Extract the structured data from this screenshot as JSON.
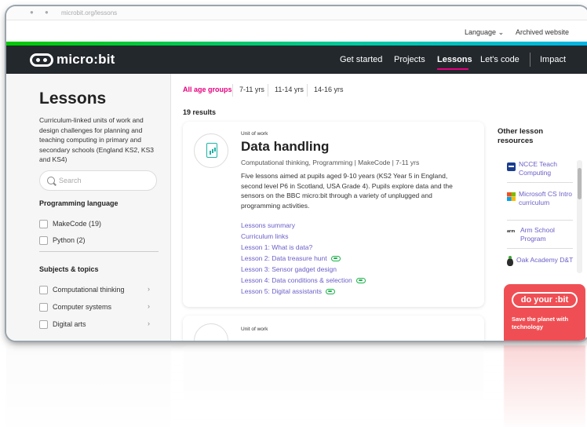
{
  "browser": {
    "url": "microbit.org/lessons"
  },
  "utility_nav": {
    "language": "Language",
    "archived": "Archived website"
  },
  "navbar": {
    "logo_text": "micro:bit",
    "items": [
      {
        "label": "Get started"
      },
      {
        "label": "Projects"
      },
      {
        "label": "Lessons"
      },
      {
        "label": "Let's code"
      },
      {
        "label": "Impact"
      }
    ],
    "active_item": "Lessons"
  },
  "sidebar": {
    "title": "Lessons",
    "description": "Curriculum-linked units of work and design challenges for planning and teaching computing in primary and secondary schools (England KS2, KS3 and KS4)",
    "search_placeholder": "Search",
    "programming_heading": "Programming language",
    "languages": [
      {
        "label": "MakeCode (19)"
      },
      {
        "label": "Python (2)"
      }
    ],
    "subjects_heading": "Subjects & topics",
    "subjects": [
      {
        "label": "Computational thinking"
      },
      {
        "label": "Computer systems"
      },
      {
        "label": "Digital arts"
      }
    ]
  },
  "filters": {
    "items": [
      {
        "label": "All age groups"
      },
      {
        "label": "7-11 yrs"
      },
      {
        "label": "11-14 yrs"
      },
      {
        "label": "14-16 yrs"
      }
    ],
    "active": "All age groups"
  },
  "results_count": "19 results",
  "card": {
    "unit_label": "Unit of work",
    "title": "Data handling",
    "meta": "Computational thinking, Programming | MakeCode | 7-11 yrs",
    "description": "Five lessons aimed at pupils aged 9-10 years (KS2 Year 5 in England, second level P6 in Scotland, USA Grade 4). Pupils explore data and the sensors on the BBC micro:bit through a variety of unplugged and programming activities.",
    "links": [
      {
        "label": "Lessons summary",
        "has_link_icon": false
      },
      {
        "label": "Curriculum links",
        "has_link_icon": false
      },
      {
        "label": "Lesson 1: What is data?",
        "has_link_icon": false
      },
      {
        "label": "Lesson 2: Data treasure hunt",
        "has_link_icon": true
      },
      {
        "label": "Lesson 3: Sensor gadget design",
        "has_link_icon": false
      },
      {
        "label": "Lesson 4: Data conditions & selection",
        "has_link_icon": true
      },
      {
        "label": "Lesson 5: Digital assistants",
        "has_link_icon": true
      }
    ]
  },
  "card2": {
    "unit_label": "Unit of work"
  },
  "aside": {
    "title": "Other lesson resources",
    "resources": [
      {
        "label": "NCCE Teach Computing",
        "icon": "ncce-icon"
      },
      {
        "label": "Microsoft CS Intro curriculum",
        "icon": "microsoft-icon"
      },
      {
        "label": "Arm School Program",
        "icon": "arm-icon",
        "icon_text": "arm"
      },
      {
        "label": "Oak Academy D&T",
        "icon": "oak-icon"
      }
    ],
    "promo": {
      "badge": "do your :bit",
      "text": "Save the planet with technology"
    }
  },
  "colors": {
    "accent_pink": "#e6007e",
    "navbar_bg": "#23282d",
    "link_purple": "#6b5fc7",
    "promo_red": "#ef4f54",
    "link_icon_green": "#1ab34a"
  }
}
